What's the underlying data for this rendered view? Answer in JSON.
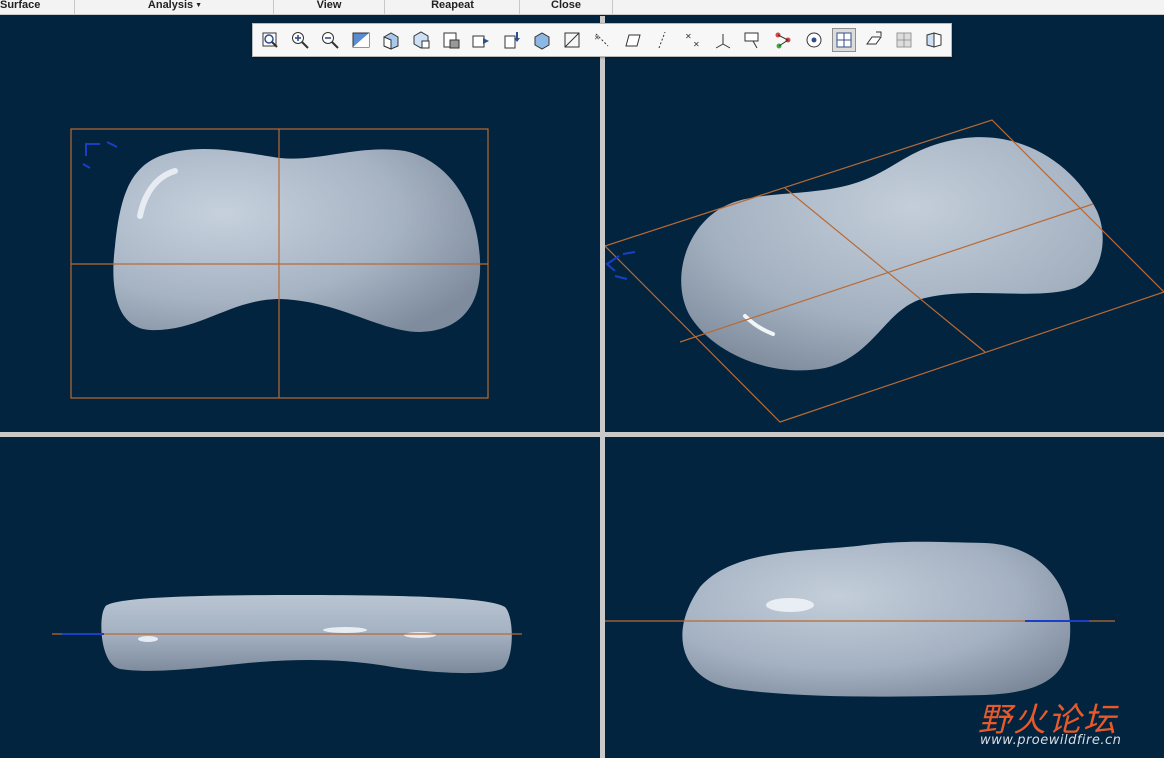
{
  "menubar": {
    "items": [
      {
        "label": "Surface"
      },
      {
        "label": "Analysis",
        "has_dropdown": true
      },
      {
        "label": "View"
      },
      {
        "label": "Reapeat"
      },
      {
        "label": "Close"
      }
    ]
  },
  "toolbar": {
    "icons": [
      "zoom-fit-icon",
      "zoom-in-icon",
      "zoom-out-icon",
      "repaint-icon",
      "shading-icon",
      "saved-views-icon",
      "named-view-icon",
      "view-manager-icon",
      "perspective-icon",
      "orient-icon",
      "display-style-icon",
      "datum-plane-display-icon",
      "plane-tag-icon",
      "axis-display-icon",
      "point-display-icon",
      "csys-display-icon",
      "annotation-display-icon",
      "curve-display-icon",
      "spin-center-icon",
      "four-view-layout-icon",
      "plane-rotate-icon",
      "single-view-layout-icon",
      "mirror-view-icon"
    ],
    "active_icon": "four-view-layout-icon"
  },
  "viewports": [
    {
      "name": "top-view",
      "view": "Top"
    },
    {
      "name": "isometric-view",
      "view": "Default"
    },
    {
      "name": "front-view",
      "view": "Front"
    },
    {
      "name": "side-view",
      "view": "Right"
    }
  ],
  "colors": {
    "background": "#02243f",
    "datum": "#b86a35",
    "model": "#a4b1c2",
    "accent_logo": "#e8592a"
  },
  "watermark": {
    "title": "野火论坛",
    "url": "www.proewildfire.cn"
  }
}
